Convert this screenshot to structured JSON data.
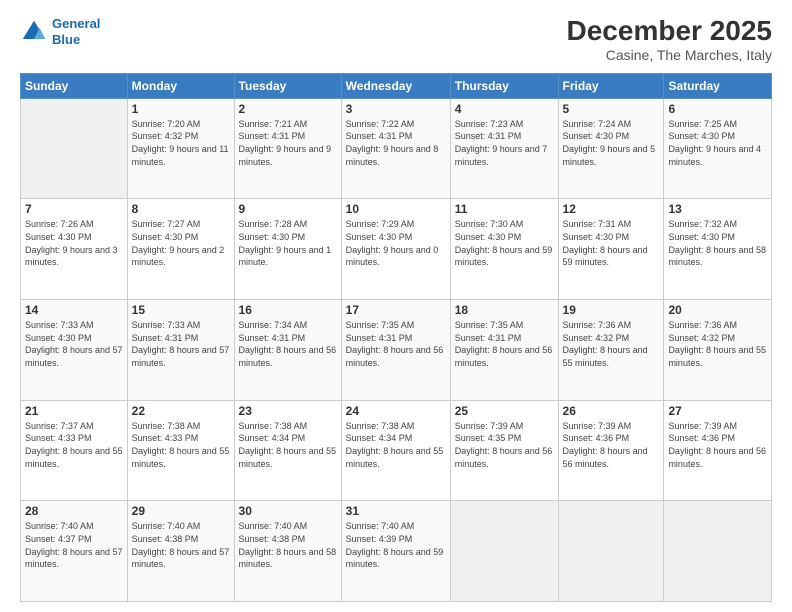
{
  "logo": {
    "line1": "General",
    "line2": "Blue"
  },
  "header": {
    "title": "December 2025",
    "subtitle": "Casine, The Marches, Italy"
  },
  "days_of_week": [
    "Sunday",
    "Monday",
    "Tuesday",
    "Wednesday",
    "Thursday",
    "Friday",
    "Saturday"
  ],
  "weeks": [
    [
      {
        "day": "",
        "sunrise": "",
        "sunset": "",
        "daylight": ""
      },
      {
        "day": "1",
        "sunrise": "Sunrise: 7:20 AM",
        "sunset": "Sunset: 4:32 PM",
        "daylight": "Daylight: 9 hours and 11 minutes."
      },
      {
        "day": "2",
        "sunrise": "Sunrise: 7:21 AM",
        "sunset": "Sunset: 4:31 PM",
        "daylight": "Daylight: 9 hours and 9 minutes."
      },
      {
        "day": "3",
        "sunrise": "Sunrise: 7:22 AM",
        "sunset": "Sunset: 4:31 PM",
        "daylight": "Daylight: 9 hours and 8 minutes."
      },
      {
        "day": "4",
        "sunrise": "Sunrise: 7:23 AM",
        "sunset": "Sunset: 4:31 PM",
        "daylight": "Daylight: 9 hours and 7 minutes."
      },
      {
        "day": "5",
        "sunrise": "Sunrise: 7:24 AM",
        "sunset": "Sunset: 4:30 PM",
        "daylight": "Daylight: 9 hours and 5 minutes."
      },
      {
        "day": "6",
        "sunrise": "Sunrise: 7:25 AM",
        "sunset": "Sunset: 4:30 PM",
        "daylight": "Daylight: 9 hours and 4 minutes."
      }
    ],
    [
      {
        "day": "7",
        "sunrise": "Sunrise: 7:26 AM",
        "sunset": "Sunset: 4:30 PM",
        "daylight": "Daylight: 9 hours and 3 minutes."
      },
      {
        "day": "8",
        "sunrise": "Sunrise: 7:27 AM",
        "sunset": "Sunset: 4:30 PM",
        "daylight": "Daylight: 9 hours and 2 minutes."
      },
      {
        "day": "9",
        "sunrise": "Sunrise: 7:28 AM",
        "sunset": "Sunset: 4:30 PM",
        "daylight": "Daylight: 9 hours and 1 minute."
      },
      {
        "day": "10",
        "sunrise": "Sunrise: 7:29 AM",
        "sunset": "Sunset: 4:30 PM",
        "daylight": "Daylight: 9 hours and 0 minutes."
      },
      {
        "day": "11",
        "sunrise": "Sunrise: 7:30 AM",
        "sunset": "Sunset: 4:30 PM",
        "daylight": "Daylight: 8 hours and 59 minutes."
      },
      {
        "day": "12",
        "sunrise": "Sunrise: 7:31 AM",
        "sunset": "Sunset: 4:30 PM",
        "daylight": "Daylight: 8 hours and 59 minutes."
      },
      {
        "day": "13",
        "sunrise": "Sunrise: 7:32 AM",
        "sunset": "Sunset: 4:30 PM",
        "daylight": "Daylight: 8 hours and 58 minutes."
      }
    ],
    [
      {
        "day": "14",
        "sunrise": "Sunrise: 7:33 AM",
        "sunset": "Sunset: 4:30 PM",
        "daylight": "Daylight: 8 hours and 57 minutes."
      },
      {
        "day": "15",
        "sunrise": "Sunrise: 7:33 AM",
        "sunset": "Sunset: 4:31 PM",
        "daylight": "Daylight: 8 hours and 57 minutes."
      },
      {
        "day": "16",
        "sunrise": "Sunrise: 7:34 AM",
        "sunset": "Sunset: 4:31 PM",
        "daylight": "Daylight: 8 hours and 56 minutes."
      },
      {
        "day": "17",
        "sunrise": "Sunrise: 7:35 AM",
        "sunset": "Sunset: 4:31 PM",
        "daylight": "Daylight: 8 hours and 56 minutes."
      },
      {
        "day": "18",
        "sunrise": "Sunrise: 7:35 AM",
        "sunset": "Sunset: 4:31 PM",
        "daylight": "Daylight: 8 hours and 56 minutes."
      },
      {
        "day": "19",
        "sunrise": "Sunrise: 7:36 AM",
        "sunset": "Sunset: 4:32 PM",
        "daylight": "Daylight: 8 hours and 55 minutes."
      },
      {
        "day": "20",
        "sunrise": "Sunrise: 7:36 AM",
        "sunset": "Sunset: 4:32 PM",
        "daylight": "Daylight: 8 hours and 55 minutes."
      }
    ],
    [
      {
        "day": "21",
        "sunrise": "Sunrise: 7:37 AM",
        "sunset": "Sunset: 4:33 PM",
        "daylight": "Daylight: 8 hours and 55 minutes."
      },
      {
        "day": "22",
        "sunrise": "Sunrise: 7:38 AM",
        "sunset": "Sunset: 4:33 PM",
        "daylight": "Daylight: 8 hours and 55 minutes."
      },
      {
        "day": "23",
        "sunrise": "Sunrise: 7:38 AM",
        "sunset": "Sunset: 4:34 PM",
        "daylight": "Daylight: 8 hours and 55 minutes."
      },
      {
        "day": "24",
        "sunrise": "Sunrise: 7:38 AM",
        "sunset": "Sunset: 4:34 PM",
        "daylight": "Daylight: 8 hours and 55 minutes."
      },
      {
        "day": "25",
        "sunrise": "Sunrise: 7:39 AM",
        "sunset": "Sunset: 4:35 PM",
        "daylight": "Daylight: 8 hours and 56 minutes."
      },
      {
        "day": "26",
        "sunrise": "Sunrise: 7:39 AM",
        "sunset": "Sunset: 4:36 PM",
        "daylight": "Daylight: 8 hours and 56 minutes."
      },
      {
        "day": "27",
        "sunrise": "Sunrise: 7:39 AM",
        "sunset": "Sunset: 4:36 PM",
        "daylight": "Daylight: 8 hours and 56 minutes."
      }
    ],
    [
      {
        "day": "28",
        "sunrise": "Sunrise: 7:40 AM",
        "sunset": "Sunset: 4:37 PM",
        "daylight": "Daylight: 8 hours and 57 minutes."
      },
      {
        "day": "29",
        "sunrise": "Sunrise: 7:40 AM",
        "sunset": "Sunset: 4:38 PM",
        "daylight": "Daylight: 8 hours and 57 minutes."
      },
      {
        "day": "30",
        "sunrise": "Sunrise: 7:40 AM",
        "sunset": "Sunset: 4:38 PM",
        "daylight": "Daylight: 8 hours and 58 minutes."
      },
      {
        "day": "31",
        "sunrise": "Sunrise: 7:40 AM",
        "sunset": "Sunset: 4:39 PM",
        "daylight": "Daylight: 8 hours and 59 minutes."
      },
      {
        "day": "",
        "sunrise": "",
        "sunset": "",
        "daylight": ""
      },
      {
        "day": "",
        "sunrise": "",
        "sunset": "",
        "daylight": ""
      },
      {
        "day": "",
        "sunrise": "",
        "sunset": "",
        "daylight": ""
      }
    ]
  ]
}
